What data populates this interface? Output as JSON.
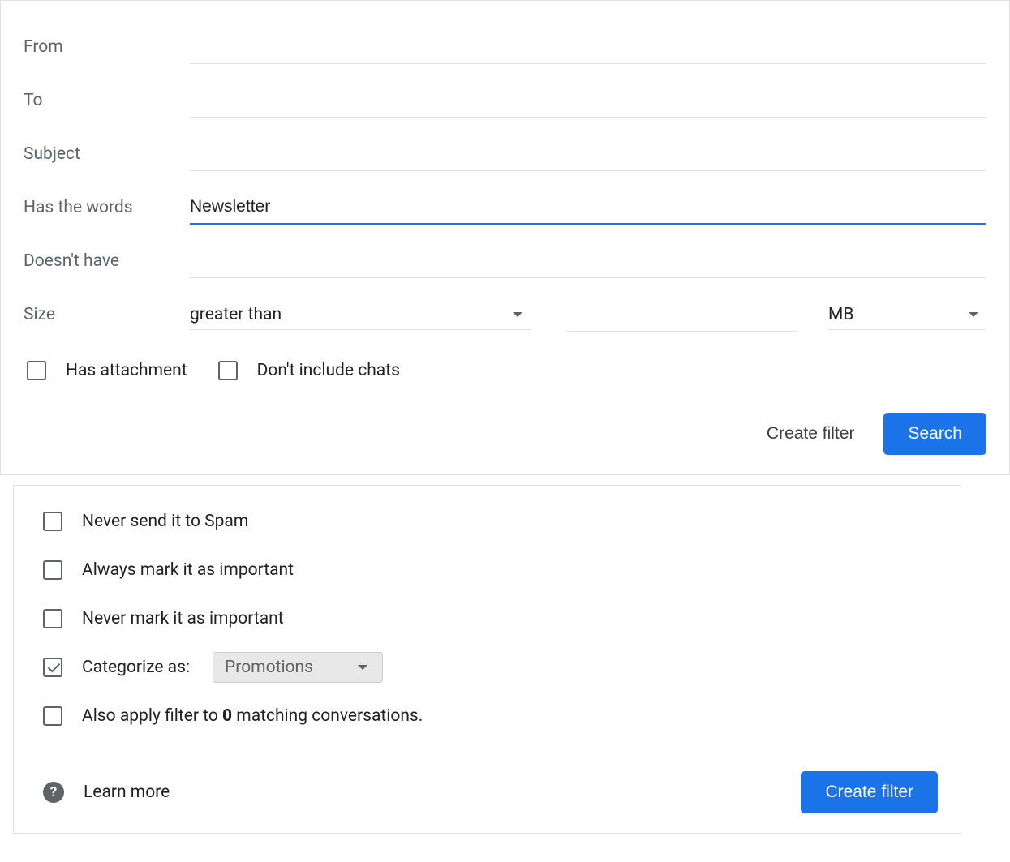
{
  "filter_form": {
    "fields": {
      "from": {
        "label": "From",
        "value": ""
      },
      "to": {
        "label": "To",
        "value": ""
      },
      "subject": {
        "label": "Subject",
        "value": ""
      },
      "has_words": {
        "label": "Has the words",
        "value": "Newsletter",
        "focused": true
      },
      "doesnt_have": {
        "label": "Doesn't have",
        "value": ""
      }
    },
    "size": {
      "label": "Size",
      "comparator": "greater than",
      "value": "",
      "unit": "MB"
    },
    "checkboxes": {
      "has_attachment": {
        "label": "Has attachment",
        "checked": false
      },
      "no_chats": {
        "label": "Don't include chats",
        "checked": false
      }
    },
    "actions": {
      "create_filter": "Create filter",
      "search": "Search"
    }
  },
  "filter_options": {
    "never_spam": {
      "label": "Never send it to Spam",
      "checked": false
    },
    "always_important": {
      "label": "Always mark it as important",
      "checked": false
    },
    "never_important": {
      "label": "Never mark it as important",
      "checked": false
    },
    "categorize": {
      "label": "Categorize as:",
      "value": "Promotions",
      "checked": true
    },
    "apply_existing": {
      "prefix": "Also apply filter to ",
      "count": "0",
      "suffix": " matching conversations.",
      "checked": false
    },
    "learn_more": "Learn more",
    "create_filter": "Create filter"
  }
}
